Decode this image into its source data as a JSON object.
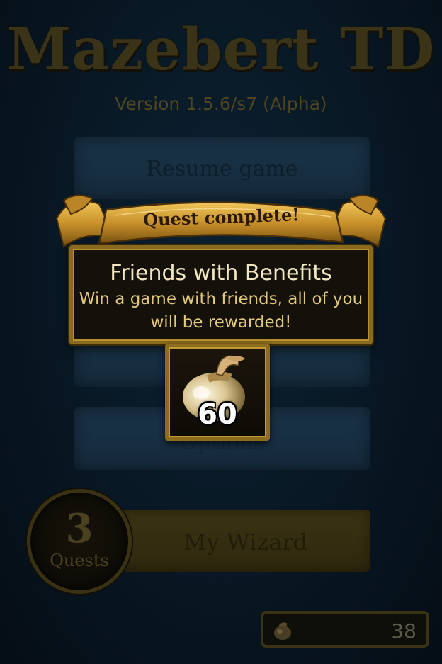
{
  "app": {
    "title": "Mazebert TD",
    "version": "Version 1.5.6/s7 (Alpha)"
  },
  "menu": {
    "resume_label": "Resume game",
    "middle_label": "",
    "options_label": "Options",
    "wizard_label": "My Wizard"
  },
  "quests": {
    "count": "3",
    "label": "Quests"
  },
  "wallet": {
    "coins": "38",
    "icon": "money-bag-icon"
  },
  "popup": {
    "banner": "Quest complete!",
    "quest_name": "Friends with Benefits",
    "description": "Win a game with friends, all of you will be rewarded!",
    "reward_amount": "60",
    "reward_icon": "money-bag-icon"
  },
  "colors": {
    "gold": "#8a6a1e",
    "title_dim": "#3a3317",
    "menu_blue": "#1a3347"
  }
}
